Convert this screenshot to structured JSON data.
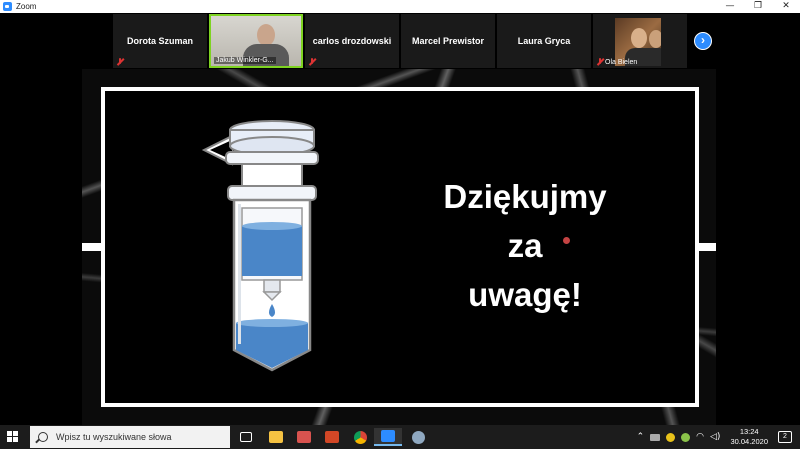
{
  "window": {
    "title": "Zoom",
    "controls": [
      "—",
      "❐",
      "✕"
    ]
  },
  "gallery": {
    "participants": [
      {
        "name": "Dorota Szuman",
        "video": false
      },
      {
        "name": "Jakub Winkler-G...",
        "video": true
      },
      {
        "name": "carlos drozdowski",
        "video": false
      },
      {
        "name": "Marcel Prewistor",
        "video": false
      },
      {
        "name": "Laura Gryca",
        "video": false
      },
      {
        "name": "Ola Bielen",
        "video": true
      }
    ],
    "next_label": "›"
  },
  "slide": {
    "lines": [
      "Dziękujmy",
      "za",
      "uwagę!"
    ]
  },
  "taskbar": {
    "search_placeholder": "Wpisz tu wyszukiwane słowa",
    "time": "13:24",
    "date": "30.04.2020",
    "notifications_count": "2"
  },
  "colors": {
    "zoom_blue": "#2d8cff",
    "speaker_border": "#7ed321",
    "tube_liquid": "#4a86c8"
  }
}
